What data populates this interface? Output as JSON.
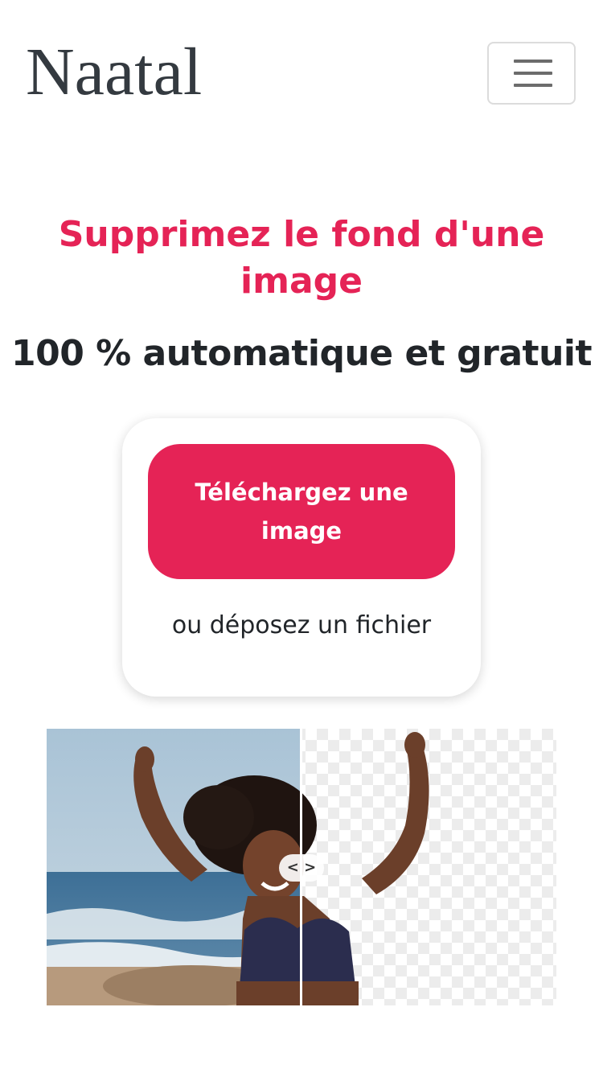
{
  "navbar": {
    "brand": "Naatal",
    "menu_icon": "hamburger-menu-icon"
  },
  "hero": {
    "title": "Supprimez le fond d'une image",
    "subtitle": "100 % automatique et gratuit"
  },
  "upload": {
    "button_label": "Téléchargez une image",
    "drop_text": "ou déposez un fichier"
  },
  "comparison": {
    "handle_glyphs": "< >",
    "divider_position": 0.5
  },
  "colors": {
    "accent": "#e52356",
    "text": "#212529",
    "brand_text": "#343a40"
  }
}
